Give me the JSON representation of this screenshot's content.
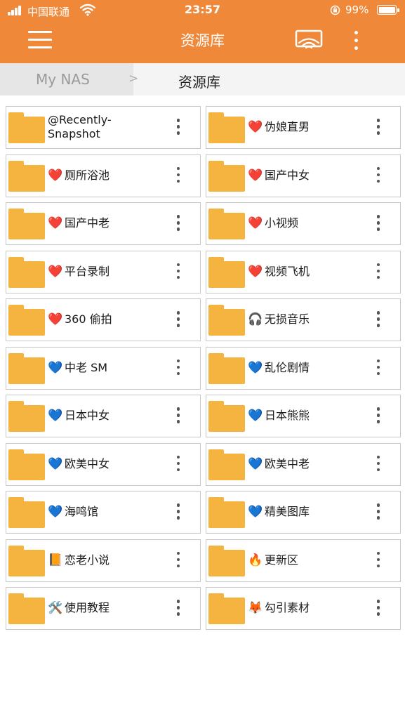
{
  "status_bar": {
    "carrier": "中国联通",
    "time": "23:57",
    "battery": "99%"
  },
  "app_bar": {
    "title": "资源库",
    "icons": [
      "menu-icon",
      "cast-icon",
      "more-vertical-icon"
    ]
  },
  "breadcrumb": {
    "root": "My NAS",
    "separator": ">",
    "current": "资源库"
  },
  "folders": [
    {
      "emoji": "",
      "name": "@Recently-\nSnapshot"
    },
    {
      "emoji": "❤️",
      "name": "伪娘直男"
    },
    {
      "emoji": "❤️",
      "name": "厕所浴池"
    },
    {
      "emoji": "❤️",
      "name": "国产中女"
    },
    {
      "emoji": "❤️",
      "name": "国产中老"
    },
    {
      "emoji": "❤️",
      "name": "小视频"
    },
    {
      "emoji": "❤️",
      "name": "平台录制"
    },
    {
      "emoji": "❤️",
      "name": "视频飞机"
    },
    {
      "emoji": "❤️",
      "name": "360 偷拍"
    },
    {
      "emoji": "🎧",
      "name": "无损音乐"
    },
    {
      "emoji": "💙",
      "name": "中老 SM"
    },
    {
      "emoji": "💙",
      "name": "乱伦剧情"
    },
    {
      "emoji": "💙",
      "name": "日本中女"
    },
    {
      "emoji": "💙",
      "name": "日本熊熊"
    },
    {
      "emoji": "💙",
      "name": "欧美中女"
    },
    {
      "emoji": "💙",
      "name": "欧美中老"
    },
    {
      "emoji": "💙",
      "name": "海鸣馆"
    },
    {
      "emoji": "💙",
      "name": "精美图库"
    },
    {
      "emoji": "📙",
      "name": "恋老小说"
    },
    {
      "emoji": "🔥",
      "name": "更新区"
    },
    {
      "emoji": "🛠️",
      "name": "使用教程"
    },
    {
      "emoji": "🦊",
      "name": "勾引素材"
    }
  ],
  "colors": {
    "header": "#f0883a",
    "folder": "#f4b43f",
    "breadcrumb_bg": "#f4f4f4"
  }
}
